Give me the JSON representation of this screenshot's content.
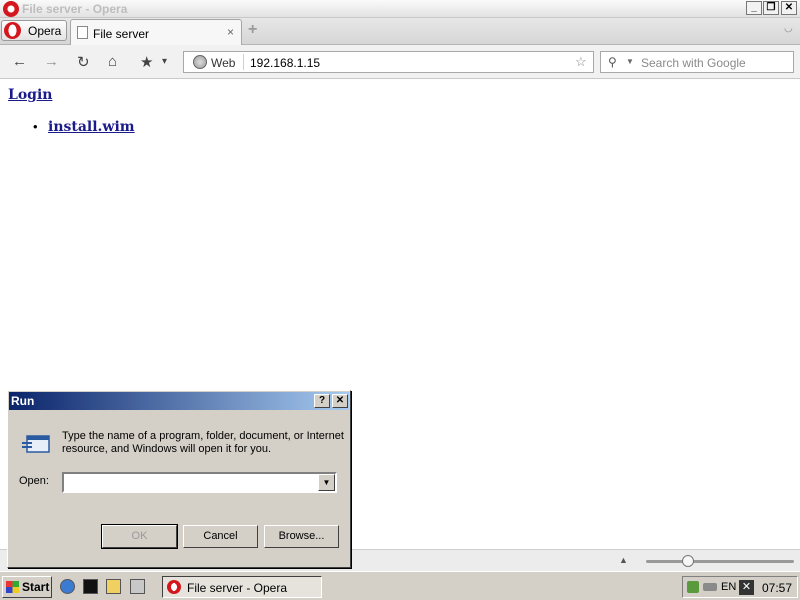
{
  "window": {
    "title": "File server - Opera",
    "controls": [
      "_",
      "❐",
      "✕"
    ]
  },
  "tabs": {
    "menu_label": "Opera",
    "active_tab": "File server",
    "close_glyph": "×",
    "new_tab_glyph": "+",
    "tab_menu_glyph": "◡"
  },
  "navbar": {
    "back": "←",
    "forward": "→",
    "reload": "↻",
    "home": "⌂",
    "bookmarks": "★",
    "bookmarks_caret": "▾",
    "address": {
      "prefix": "Web",
      "url": "192.168.1.15",
      "star": "☆"
    },
    "search": {
      "placeholder": "Search with Google",
      "icon": "⚲",
      "caret": "▼"
    }
  },
  "page": {
    "heading_link": "Login",
    "files": [
      "install.wim"
    ],
    "bullet": "•"
  },
  "statusbar": {
    "arrow": "▲",
    "zoom_fraction": 0.28
  },
  "run_dialog": {
    "title": "Run",
    "help": "?",
    "close": "✕",
    "message": "Type the name of a program, folder, document, or Internet resource, and Windows will open it for you.",
    "open_label": "Open:",
    "open_value": "",
    "dropdown_glyph": "▼",
    "buttons": {
      "ok": "OK",
      "cancel": "Cancel",
      "browse": "Browse..."
    }
  },
  "taskbar": {
    "start_label": "Start",
    "task_label": "File server - Opera",
    "tray": {
      "language": "EN",
      "time": "07:57",
      "x_glyph": "✕"
    }
  }
}
